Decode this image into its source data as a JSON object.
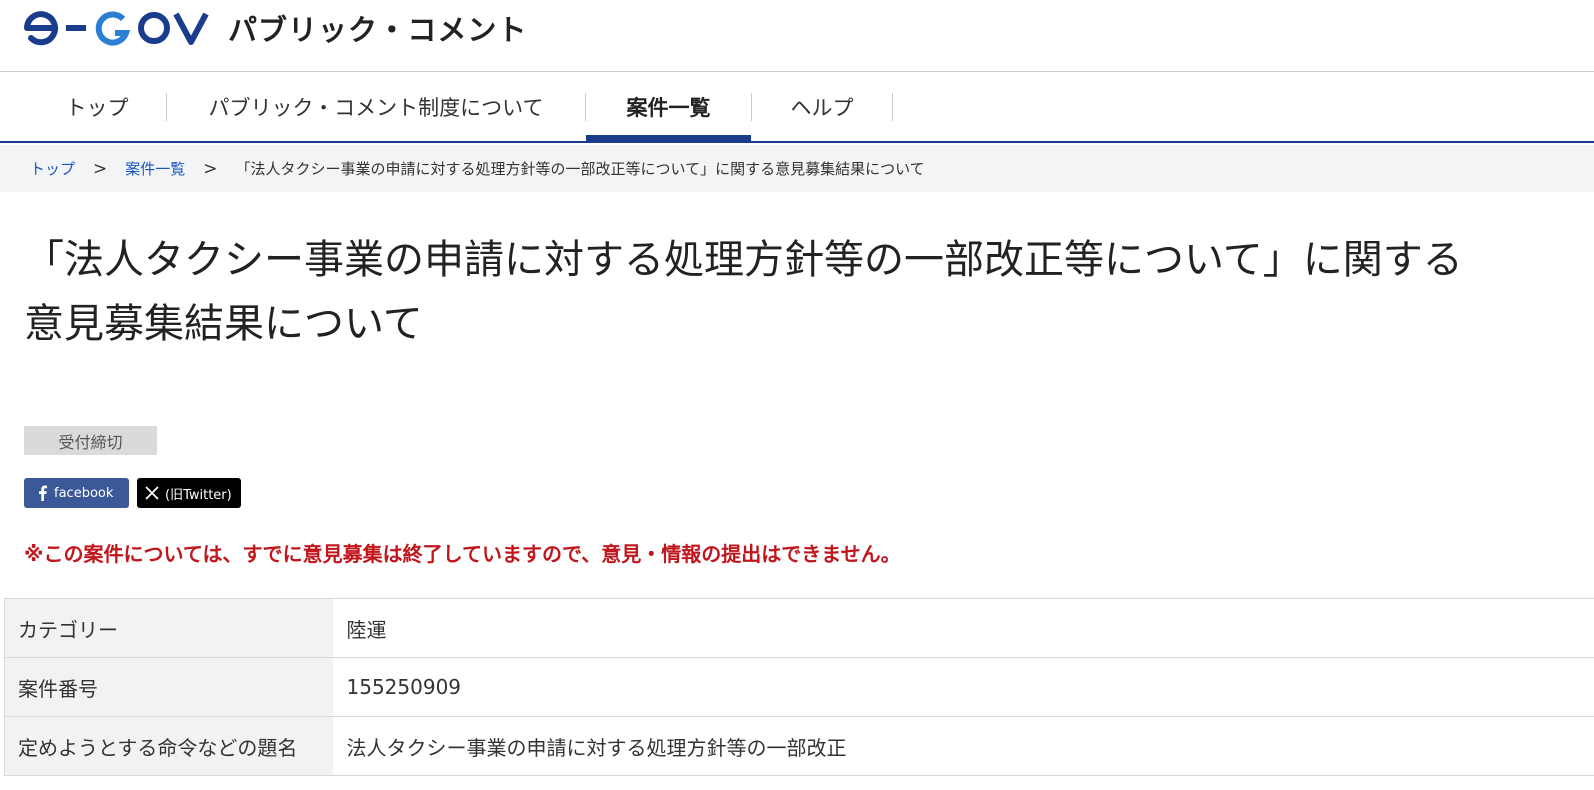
{
  "header": {
    "logo_text": "e-GOV",
    "site_title": "パブリック・コメント",
    "colors": {
      "navy": "#1a3c8c",
      "blue": "#2a7fd4"
    }
  },
  "nav": {
    "items": [
      {
        "label": "トップ"
      },
      {
        "label": "パブリック・コメント制度について"
      },
      {
        "label": "案件一覧"
      },
      {
        "label": "ヘルプ"
      }
    ],
    "active_index": 2
  },
  "breadcrumb": {
    "items": [
      "トップ",
      "案件一覧"
    ],
    "current": "「法人タクシー事業の申請に対する処理方針等の一部改正等について」に関する意見募集結果について",
    "separator": ">"
  },
  "page": {
    "title_line1": "「法人タクシー事業の申請に対する処理方針等の一部改正等について」に関する",
    "title_line2": "意見募集結果について",
    "status_badge": "受付締切",
    "share": {
      "facebook_label": "facebook",
      "x_label": "(旧Twitter)"
    },
    "notice": "※この案件については、すでに意見募集は終了していますので、意見・情報の提出はできません。",
    "notice_color": "#c0161c"
  },
  "details": {
    "rows": [
      {
        "label": "カテゴリー",
        "value": "陸運"
      },
      {
        "label": "案件番号",
        "value": "155250909"
      },
      {
        "label": "定めようとする命令などの題名",
        "value": "法人タクシー事業の申請に対する処理方針等の一部改正"
      }
    ]
  }
}
